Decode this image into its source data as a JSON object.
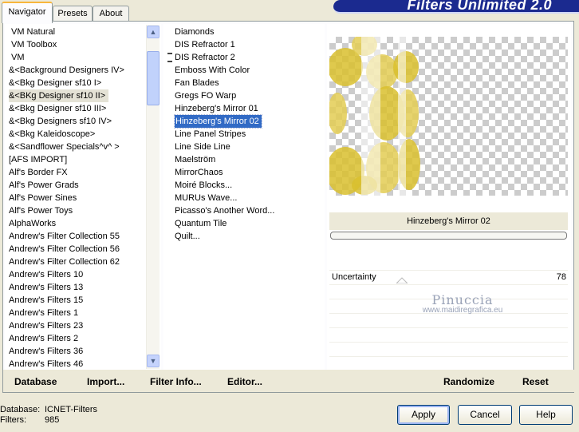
{
  "tabs": [
    "Navigator",
    "Presets",
    "About"
  ],
  "banner_title": "Filters Unlimited 2.0",
  "categories": [
    "VM Natural",
    "VM Toolbox",
    "VM",
    "&<Background Designers IV>",
    "&<Bkg Designer sf10 I>",
    "&<BKg Designer sf10 II>",
    "&<Bkg Designer sf10 III>",
    "&<Bkg Designers sf10 IV>",
    "&<Bkg Kaleidoscope>",
    "&<Sandflower Specials^v^ >",
    "[AFS IMPORT]",
    "Alf's Border FX",
    "Alf's Power Grads",
    "Alf's Power Sines",
    "Alf's Power Toys",
    "AlphaWorks",
    "Andrew's Filter Collection 55",
    "Andrew's Filter Collection 56",
    "Andrew's Filter Collection 62",
    "Andrew's Filters 10",
    "Andrew's Filters 13",
    "Andrew's Filters 15",
    "Andrew's Filters 1",
    "Andrew's Filters 23",
    "Andrew's Filters 2",
    "Andrew's Filters 36",
    "Andrew's Filters 46"
  ],
  "selected_category": "&<BKg Designer sf10 II>",
  "filters": [
    "Diamonds",
    "DIS Refractor 1",
    "DIS Refractor 2",
    "Emboss With Color",
    "Fan Blades",
    "Gregs FO Warp",
    "Hinzeberg's Mirror 01",
    "Hinzeberg's Mirror 02",
    "Line Panel Stripes",
    "Line Side Line",
    "Maelström",
    "MirrorChaos",
    "Moiré Blocks...",
    "MURUs Wave...",
    "Picasso's Another Word...",
    "Quantum Tile",
    "Quilt..."
  ],
  "selected_filter": "Hinzeberg's Mirror 02",
  "preview_filter_name": "Hinzeberg's Mirror 02",
  "parameter": {
    "label": "Uncertainty",
    "value": "78"
  },
  "watermark": {
    "line1": "Pinuccia",
    "line2": "www.maidiregrafica.eu"
  },
  "left_buttons": {
    "database": "Database",
    "import": "Import...",
    "filter_info": "Filter Info...",
    "editor": "Editor..."
  },
  "right_buttons": {
    "randomize": "Randomize",
    "reset": "Reset"
  },
  "status": {
    "database_label": "Database:",
    "database_value": "ICNET-Filters",
    "filters_label": "Filters:",
    "filters_value": "985"
  },
  "dialog_buttons": {
    "apply": "Apply",
    "cancel": "Cancel",
    "help": "Help"
  },
  "colors": {
    "selection": "#316ac5",
    "banner": "#1b2a8f",
    "preview_yellow": "#d9bf2e"
  }
}
